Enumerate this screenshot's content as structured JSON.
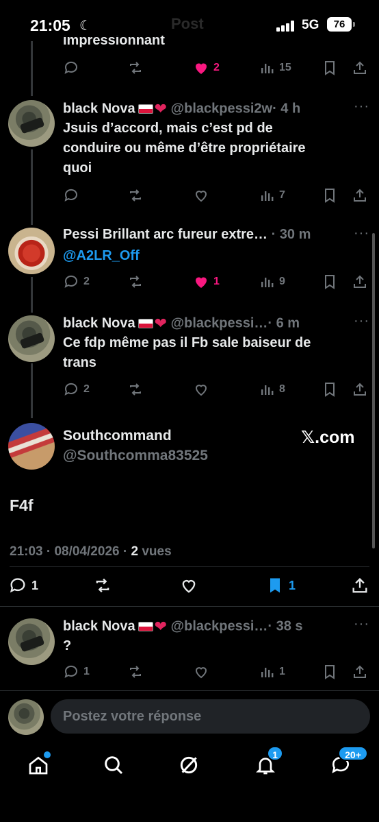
{
  "status_bar": {
    "time": "21:05",
    "network": "5G",
    "battery": "76",
    "ghost_title": "Post"
  },
  "previous_tweet": {
    "truncated_text": "impressionnant",
    "actions": {
      "replies": "",
      "retweets": "",
      "likes": "2",
      "views": "15"
    }
  },
  "replies_above": [
    {
      "name": "black Nova",
      "handle": "@blackpessi2w",
      "time": "· 4 h",
      "text_lines": [
        "Jsuis d’accord, mais c’est pd de",
        "conduire ou même d’être propriétaire",
        "quoi"
      ],
      "actions": {
        "replies": "",
        "retweets": "",
        "likes": "",
        "views": "7"
      }
    },
    {
      "name": "Pessi Brillant arc fureur extre…",
      "handle": "",
      "time": "· 30 m",
      "text_lines": [
        "@A2LR_Off"
      ],
      "actions": {
        "replies": "2",
        "retweets": "",
        "likes": "1",
        "views": "9"
      }
    },
    {
      "name": "black Nova",
      "handle": "@blackpessi…",
      "time": "· 6 m",
      "text_lines": [
        "Ce fdp même pas il Fb sale baiseur de",
        "trans"
      ],
      "actions": {
        "replies": "2",
        "retweets": "",
        "likes": "",
        "views": "8"
      }
    }
  ],
  "main_post": {
    "name": "Southcommand",
    "handle": "@Southcomma83525",
    "source_logo": "𝕏.com",
    "text": "F4f",
    "timestamp": "21:03 · 08/04/2026 · ",
    "views_count": "2",
    "views_label": " vues",
    "actions": {
      "replies": "1",
      "bookmarks": "1"
    }
  },
  "reply_below": {
    "name": "black Nova",
    "handle": "@blackpessi…",
    "time": "· 38 s",
    "text": "?",
    "actions": {
      "replies": "1",
      "retweets": "",
      "likes": "",
      "views": "1"
    }
  },
  "reply_box": {
    "placeholder": "Postez votre réponse"
  },
  "bottom_nav": {
    "notifications_badge": "1",
    "messages_badge": "20+"
  },
  "colors": {
    "accent": "#1d9bf0",
    "like": "#f91880",
    "muted": "#71767b",
    "background": "#000000"
  }
}
